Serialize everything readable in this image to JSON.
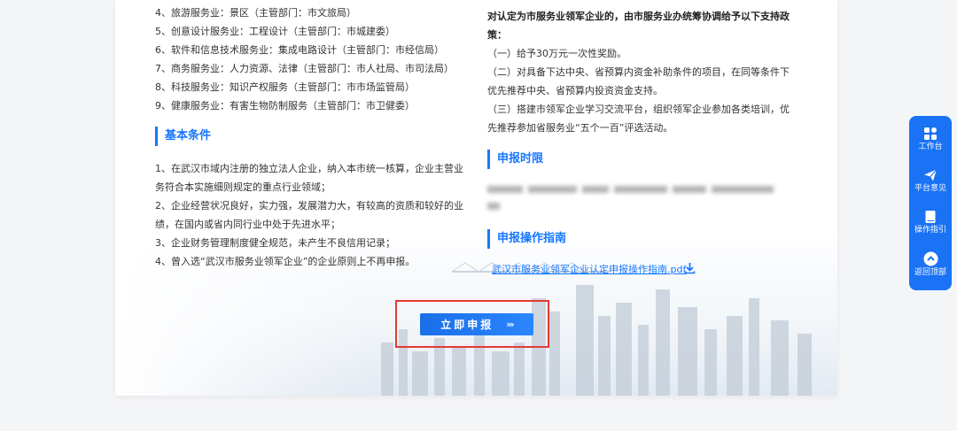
{
  "industries": [
    "4、旅游服务业：景区（主管部门：市文旅局）",
    "5、创意设计服务业：工程设计（主管部门：市城建委）",
    "6、软件和信息技术服务业：集成电路设计（主管部门：市经信局）",
    "7、商务服务业：人力资源、法律（主管部门：市人社局、市司法局）",
    "8、科技服务业：知识产权服务（主管部门：市市场监管局）",
    "9、健康服务业：有害生物防制服务（主管部门：市卫健委）"
  ],
  "basic_conditions": {
    "title": "基本条件",
    "items": [
      "1、在武汉市域内注册的独立法人企业，纳入本市统一核算，企业主营业务符合本实施细则规定的重点行业领域；",
      "2、企业经营状况良好，实力强，发展潜力大，有较高的资质和较好的业绩，在国内或省内同行业中处于先进水平；",
      "3、企业财务管理制度健全规范，未产生不良信用记录；",
      "4、曾入选“武汉市服务业领军企业”的企业原则上不再申报。"
    ]
  },
  "support_policy": {
    "intro": "对认定为市服务业领军企业的，由市服务业办统筹协调给予以下支持政策：",
    "items": [
      "（一）给予30万元一次性奖励。",
      "（二）对具备下达中央、省预算内资金补助条件的项目，在同等条件下优先推荐中央、省预算内投资资金支持。",
      "（三）搭建市领军企业学习交流平台，组织领军企业参加各类培训，优先推荐参加省服务业“五个一百”评选活动。"
    ]
  },
  "apply_time": {
    "title": "申报时限"
  },
  "apply_guide": {
    "title": "申报操作指南",
    "file_link": "武汉市服务业领军企业认定申报操作指南.pdf"
  },
  "apply_button": {
    "label": "立即申报",
    "chevrons": "›››"
  },
  "float_bar": {
    "items": [
      {
        "label": "工作台",
        "icon": "grid-icon"
      },
      {
        "label": "平台意见",
        "icon": "send-icon"
      },
      {
        "label": "操作指引",
        "icon": "book-icon"
      },
      {
        "label": "返回顶部",
        "icon": "chevron-up-icon"
      }
    ]
  },
  "colors": {
    "accent": "#1677ff",
    "highlight_box": "#e53935",
    "float_bar": "#1a72f5"
  }
}
